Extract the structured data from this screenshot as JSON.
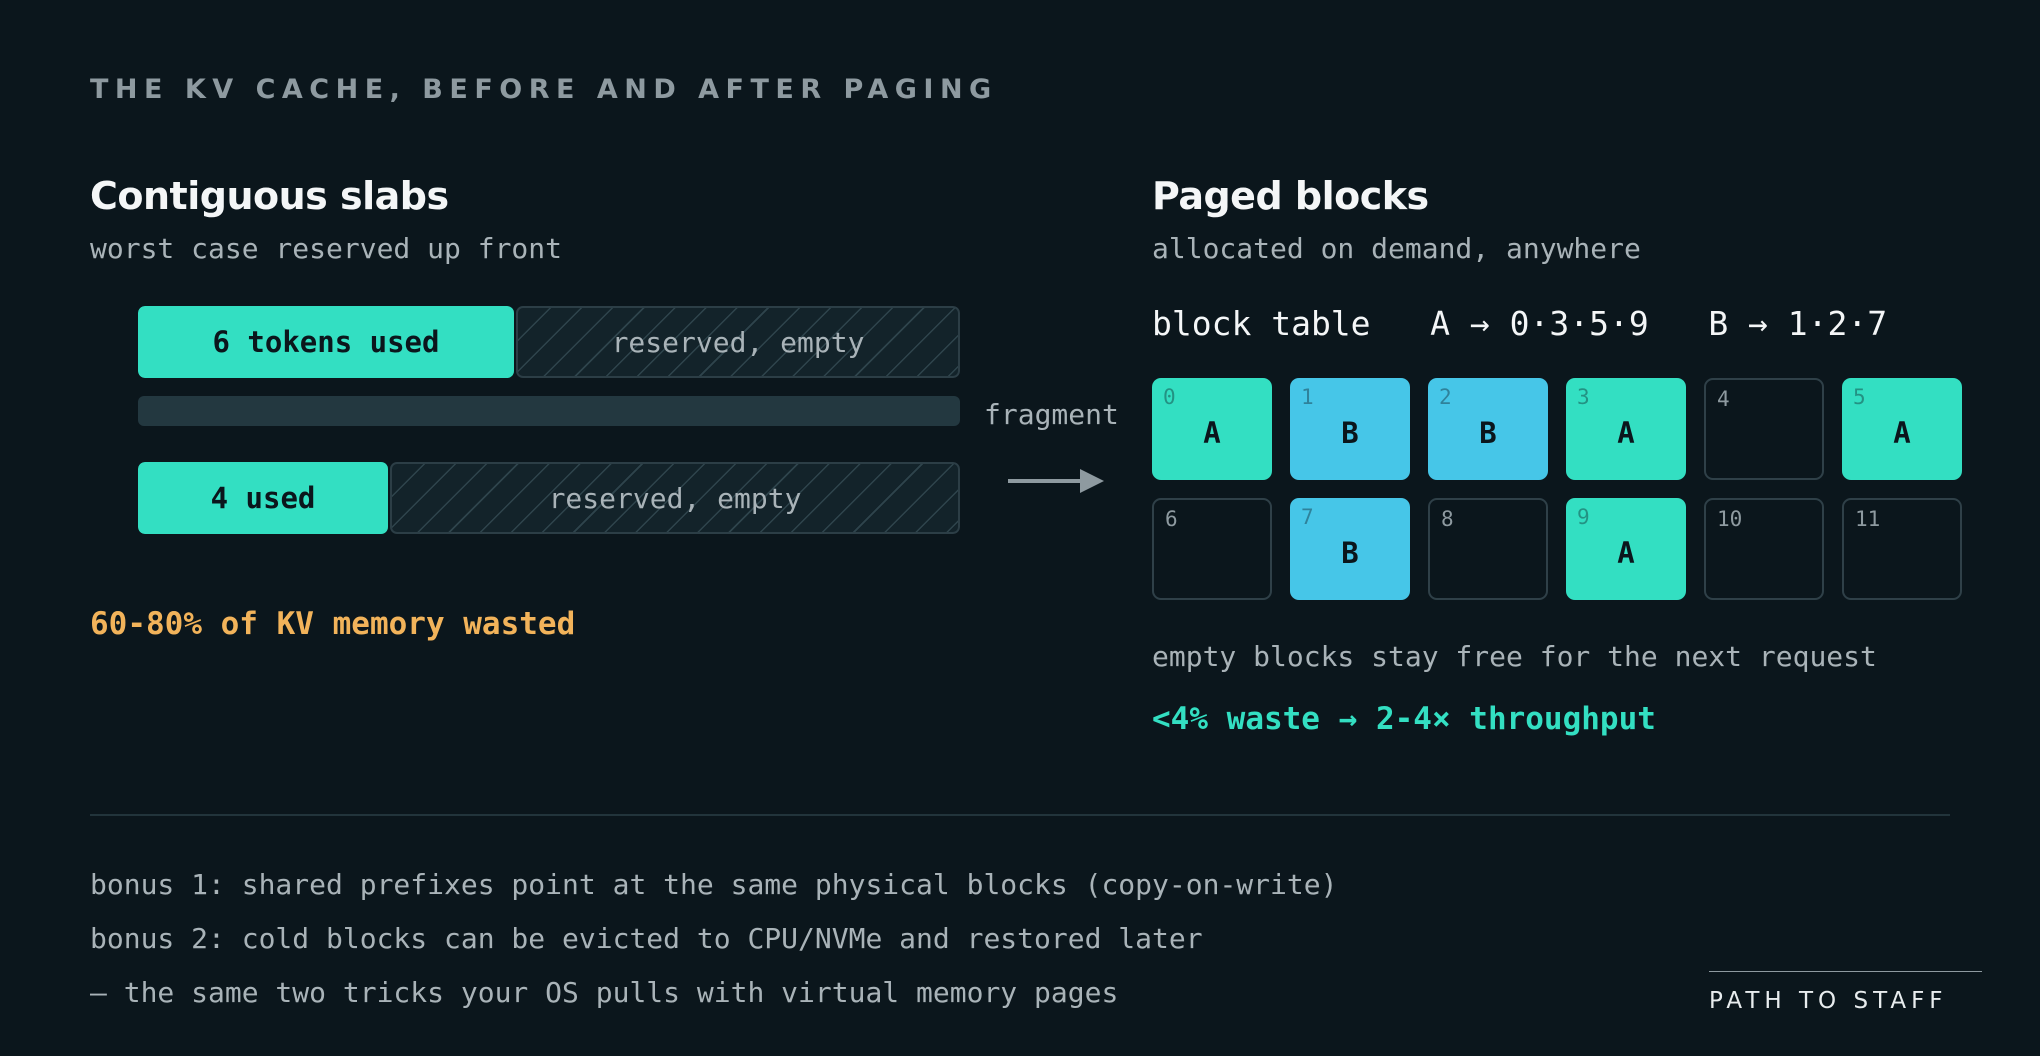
{
  "eyebrow": "THE KV CACHE, BEFORE AND AFTER PAGING",
  "left": {
    "title": "Contiguous slabs",
    "subtitle": "worst case reserved up front",
    "slab1": {
      "used_label": "6 tokens used",
      "reserved_label": "reserved, empty"
    },
    "slab2": {
      "used_label": "4 used",
      "reserved_label": "reserved, empty"
    },
    "waste_note": "60-80% of KV memory wasted"
  },
  "transition": {
    "label": "fragment",
    "icon": "right-arrow-icon"
  },
  "right": {
    "title": "Paged blocks",
    "subtitle": "allocated on demand, anywhere",
    "block_table": {
      "label": "block table",
      "mapping_a": "A → 0·3·5·9",
      "mapping_b": "B → 1·2·7"
    },
    "blocks": [
      {
        "num": "0",
        "seq": "A"
      },
      {
        "num": "1",
        "seq": "B"
      },
      {
        "num": "2",
        "seq": "B"
      },
      {
        "num": "3",
        "seq": "A"
      },
      {
        "num": "4",
        "seq": ""
      },
      {
        "num": "5",
        "seq": "A"
      },
      {
        "num": "6",
        "seq": ""
      },
      {
        "num": "7",
        "seq": "B"
      },
      {
        "num": "8",
        "seq": ""
      },
      {
        "num": "9",
        "seq": "A"
      },
      {
        "num": "10",
        "seq": ""
      },
      {
        "num": "11",
        "seq": ""
      }
    ],
    "free_note": "empty blocks stay free for the next request",
    "result": "<4% waste → 2-4× throughput"
  },
  "bonus": [
    "bonus 1: shared prefixes point at the same physical blocks (copy-on-write)",
    "bonus 2: cold blocks can be evicted to CPU/NVMe and restored later",
    "— the same two tricks your OS pulls with virtual memory pages"
  ],
  "brand": "PATH TO STAFF",
  "colors": {
    "background": "#0b161c",
    "sequence_a": "#33dfc2",
    "sequence_b": "#46c6e8",
    "waste_warning": "#f2b35a",
    "muted_text": "#a9b3b8"
  }
}
